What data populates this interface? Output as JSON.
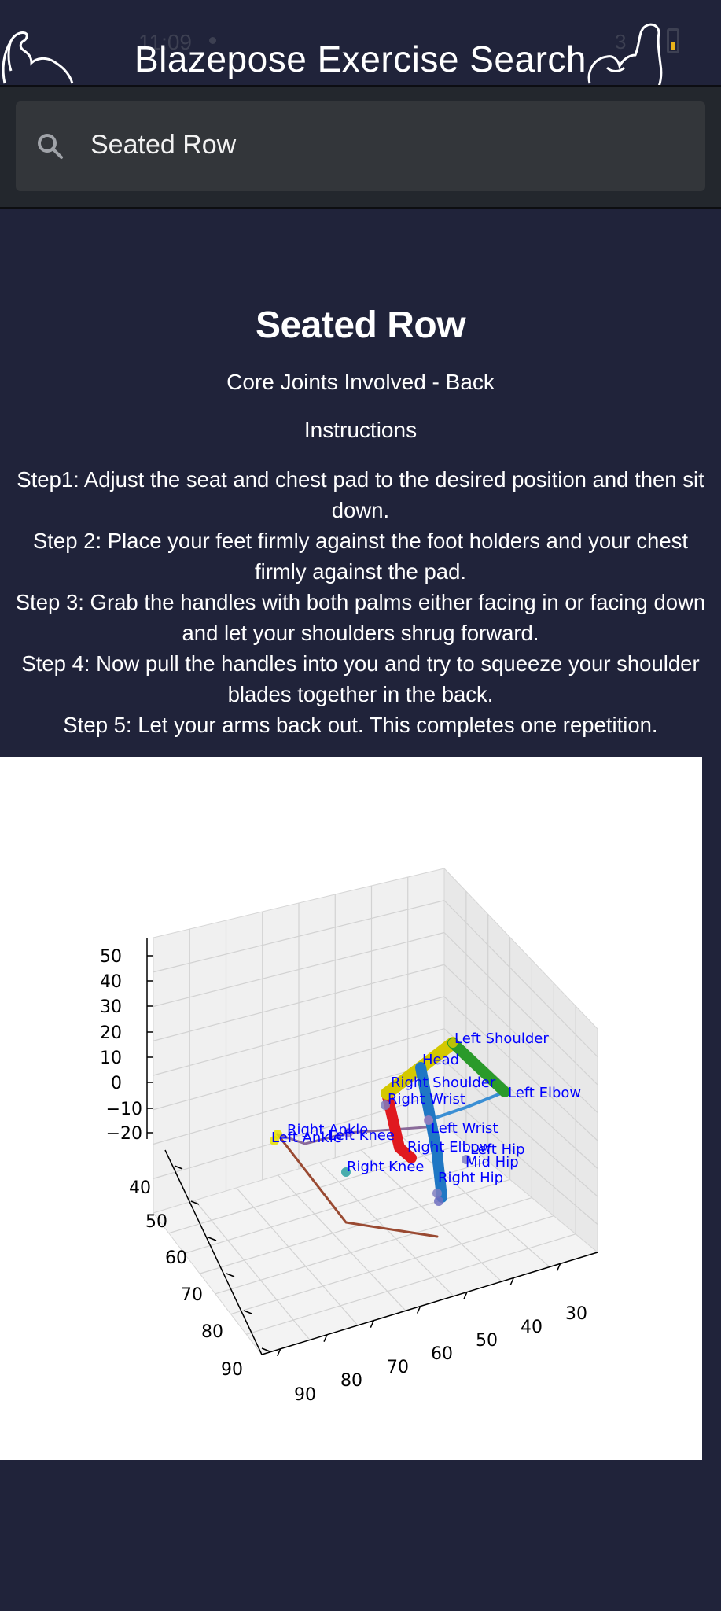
{
  "status_bar": {
    "time": "11:09",
    "battery": "3"
  },
  "header": {
    "title": "Blazepose Exercise Search",
    "left_logo_icon": "flexed-arm-icon",
    "right_logo_icon": "flexed-arm-icon"
  },
  "search": {
    "value": "Seated Row",
    "icon": "search-icon"
  },
  "exercise": {
    "name": "Seated Row",
    "core_joints": "Core Joints Involved - Back",
    "instructions_heading": "Instructions",
    "steps": [
      "Step1: Adjust the seat and chest pad to the desired position and then sit down.",
      "Step 2: Place your feet firmly against the foot holders and your chest firmly against the pad.",
      "Step 3: Grab the handles with both palms either facing in or facing down and let your shoulders shrug forward.",
      "Step 4: Now pull the handles into you and try to squeeze your shoulder blades together in the back.",
      "Step 5: Let your arms back out. This completes one repetition."
    ]
  },
  "chart_data": {
    "type": "scatter",
    "projection": "3d",
    "z_ticks": [
      "50",
      "40",
      "30",
      "20",
      "10",
      "0",
      "−10",
      "−20"
    ],
    "left_axis_ticks": [
      "40",
      "50",
      "60",
      "70",
      "80",
      "90"
    ],
    "bottom_axis_ticks": [
      "90",
      "80",
      "70",
      "60",
      "50",
      "40",
      "30"
    ],
    "landmarks": [
      {
        "label": "Left Shoulder"
      },
      {
        "label": "Head"
      },
      {
        "label": "Right Shoulder"
      },
      {
        "label": "Right Wrist"
      },
      {
        "label": "Left Elbow"
      },
      {
        "label": "Right Ankle"
      },
      {
        "label": "Left Ankle"
      },
      {
        "label": "Left Knee"
      },
      {
        "label": "Left Wrist"
      },
      {
        "label": "Right Elbow"
      },
      {
        "label": "Left Hip"
      },
      {
        "label": "Right Knee"
      },
      {
        "label": "Mid Hip"
      },
      {
        "label": "Right Hip"
      }
    ],
    "colors": {
      "label_text": "#0000ff",
      "segment_yellow": "#d4c800",
      "segment_green": "#2a9a2a",
      "segment_blue": "#1f77c4",
      "segment_red": "#e0191f",
      "segment_brown": "#9a4a32",
      "segment_lightblue": "#3b8fd4",
      "segment_purple": "#8a6b9a"
    },
    "grid": true
  }
}
